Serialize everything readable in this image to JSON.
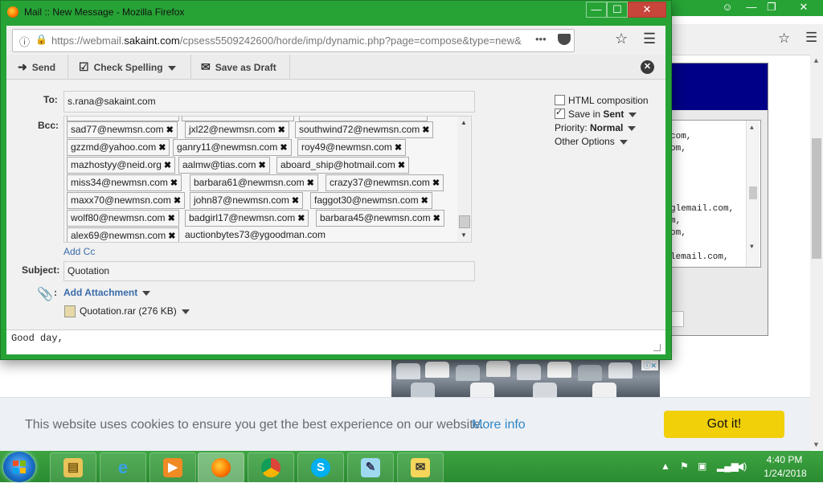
{
  "window": {
    "title": "Mail :: New Message - Mozilla Firefox",
    "url_prefix": "https://webmail.",
    "url_domain": "sakaint.com",
    "url_path": "/cpsess5509242600/horde/imp/dynamic.php?page=compose&type=new&"
  },
  "toolbar": {
    "send_label": "Send",
    "spelling_label": "Check Spelling",
    "draft_label": "Save as Draft"
  },
  "compose": {
    "to_label": "To:",
    "to_value": "s.rana@sakaint.com",
    "bcc_label": "Bcc:",
    "bcc_chips": [
      "sad77@newmsn.com",
      "jxl22@newmsn.com",
      "southwind72@newmsn.com",
      "gzzmd@yahoo.com",
      "ganry11@newmsn.com",
      "roy49@newmsn.com",
      "mazhostyy@neid.org",
      "aalmw@tias.com",
      "aboard_ship@hotmail.com",
      "miss34@newmsn.com",
      "barbara61@newmsn.com",
      "crazy37@newmsn.com",
      "maxx70@newmsn.com",
      "john87@newmsn.com",
      "faggot30@newmsn.com",
      "wolf80@newmsn.com",
      "badgirl17@newmsn.com",
      "barbara45@newmsn.com",
      "alex69@newmsn.com"
    ],
    "bcc_typing": "auctionbytes73@ygoodman.com",
    "add_cc": "Add Cc",
    "subject_label": "Subject:",
    "subject_value": "Quotation",
    "add_attachment": "Add Attachment",
    "attachment": "Quotation.rar (276 KB)",
    "body": "Good day,"
  },
  "options": {
    "html_composition": "HTML composition",
    "save_in": "Save in",
    "save_folder": "Sent",
    "priority_label": "Priority:",
    "priority_value": "Normal",
    "other_options": "Other Options"
  },
  "background": {
    "textarea_lines": [
      "com,",
      "om,",
      "",
      "",
      "",
      "",
      "glemail.com,",
      "m,",
      "om,",
      "",
      "",
      "lemail.com,"
    ]
  },
  "cookie": {
    "message": "This website uses cookies to ensure you get the best experience on our website.",
    "more_info": "More info",
    "button": "Got it!"
  },
  "clock": {
    "time": "4:40 PM",
    "date": "1/24/2018"
  },
  "colors": {
    "window_green": "#27a336",
    "cookie_button": "#f1d00a",
    "link_blue": "#2e87c8"
  }
}
